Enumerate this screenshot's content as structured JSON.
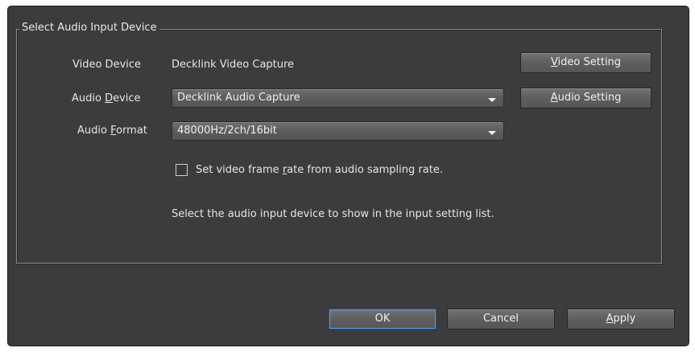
{
  "group": {
    "title": "Select Audio Input Device"
  },
  "video_device": {
    "label": "Video Device",
    "value": "Decklink Video Capture",
    "setting_button_mnemonic": "V",
    "setting_button_rest": "ideo Setting"
  },
  "audio_device": {
    "label_pre": "Audio ",
    "label_mnemonic": "D",
    "label_post": "evice",
    "selected": "Decklink Audio Capture",
    "setting_button_mnemonic": "A",
    "setting_button_rest": "udio Setting"
  },
  "audio_format": {
    "label_pre": "Audio ",
    "label_mnemonic": "F",
    "label_post": "ormat",
    "selected": "48000Hz/2ch/16bit"
  },
  "checkbox": {
    "label_pre": "Set video frame ",
    "label_mnemonic": "r",
    "label_post": "ate from audio sampling rate.",
    "checked": false
  },
  "hint": "Select the audio input device to show in the input setting list.",
  "footer": {
    "ok_label": "OK",
    "cancel_label": "Cancel",
    "apply_mnemonic": "A",
    "apply_rest": "pply"
  }
}
